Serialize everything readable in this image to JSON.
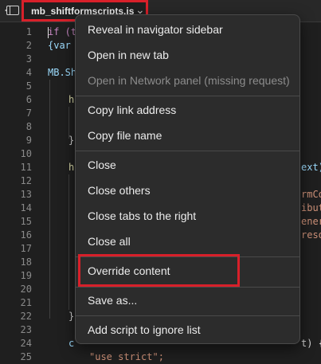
{
  "tab": {
    "title": "mb_shiftformscripts.js",
    "close_glyph": "⌄"
  },
  "editor": {
    "line_numbers": [
      "1",
      "2",
      "3",
      "4",
      "5",
      "6",
      "7",
      "8",
      "9",
      "10",
      "11",
      "12",
      "13",
      "14",
      "15",
      "16",
      "17",
      "18",
      "19",
      "20",
      "21",
      "22",
      "23",
      "24",
      "25"
    ],
    "visible_code": {
      "line1": "if (t",
      "line2": "{var",
      "line4": "MB.Sh",
      "line6": "h",
      "line9": "}",
      "line11": "h",
      "line22": "}",
      "line24": "c",
      "line25": "\"use strict\";"
    },
    "right_edge": {
      "line11": "ext)",
      "line13": "rmCo",
      "line14": "ibut",
      "line15": "ener",
      "line16": "reso",
      "line24": "t) {"
    }
  },
  "context_menu": {
    "items": [
      {
        "label": "Reveal in navigator sidebar",
        "enabled": true
      },
      {
        "label": "Open in new tab",
        "enabled": true
      },
      {
        "label": "Open in Network panel (missing request)",
        "enabled": false
      },
      {
        "label": "Copy link address",
        "enabled": true
      },
      {
        "label": "Copy file name",
        "enabled": true
      },
      {
        "label": "Close",
        "enabled": true
      },
      {
        "label": "Close others",
        "enabled": true
      },
      {
        "label": "Close tabs to the right",
        "enabled": true
      },
      {
        "label": "Close all",
        "enabled": true
      },
      {
        "label": "Override content",
        "enabled": true
      },
      {
        "label": "Save as...",
        "enabled": true
      },
      {
        "label": "Add script to ignore list",
        "enabled": true
      }
    ]
  },
  "colors": {
    "highlight_box": "#d8202a",
    "background": "#1f1f1f",
    "menu_background": "#2c2c2c"
  }
}
